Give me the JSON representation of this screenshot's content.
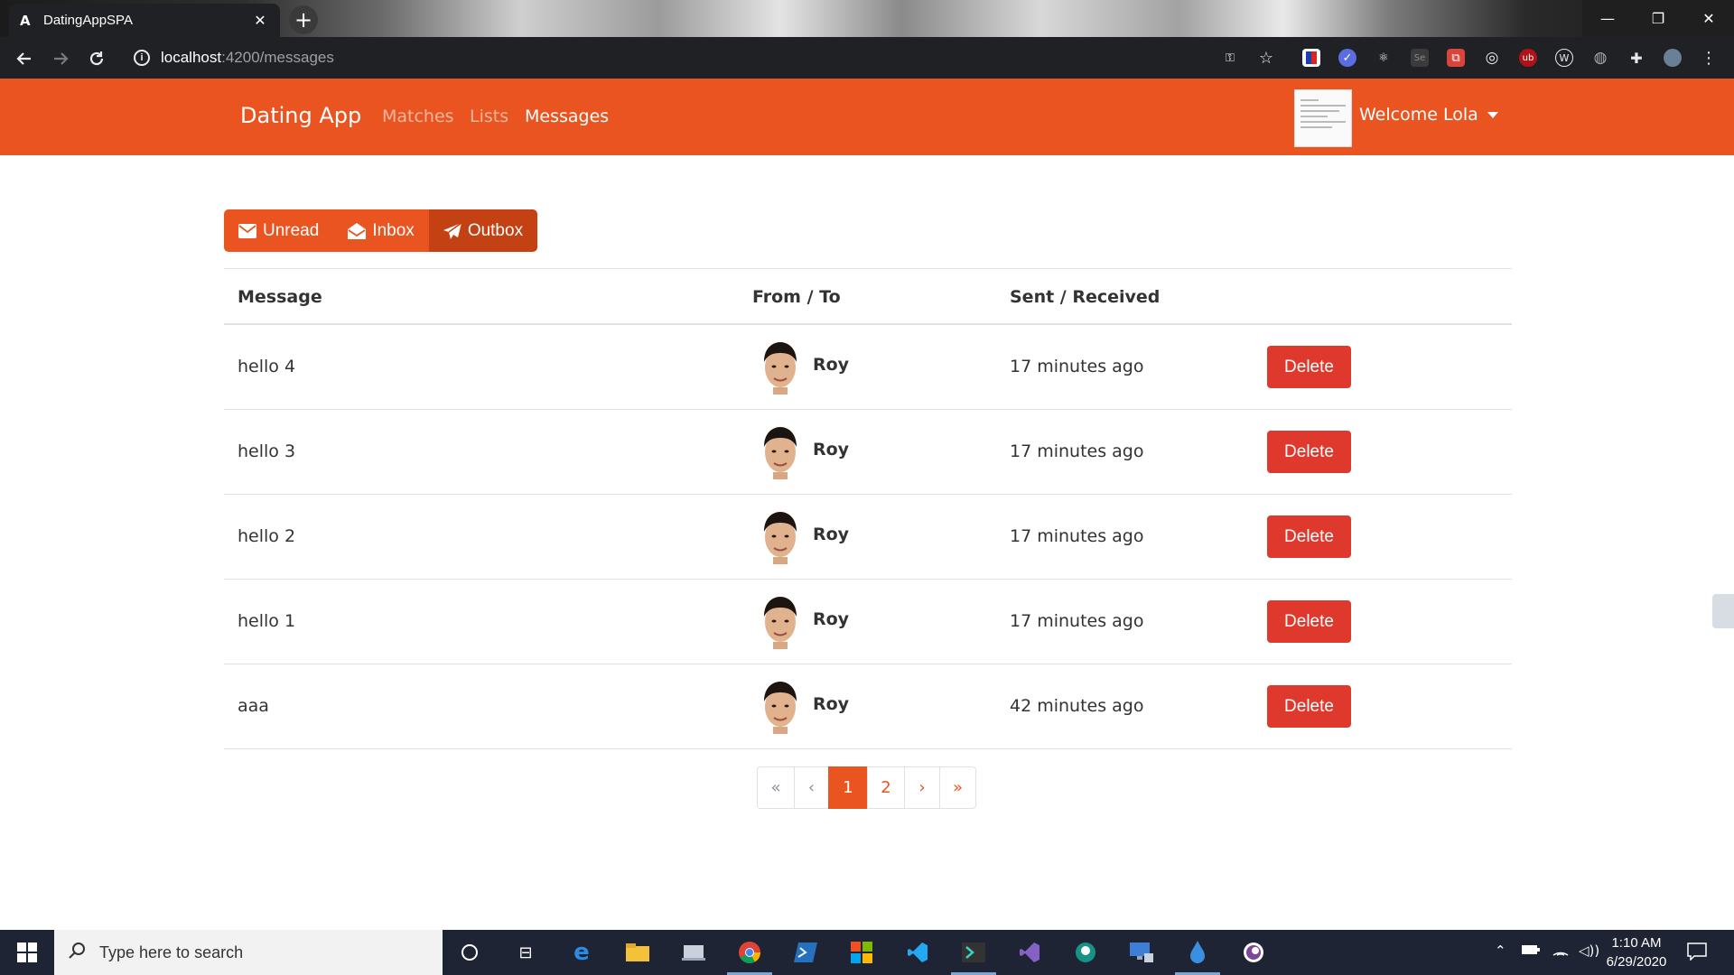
{
  "browser": {
    "tab_favicon": "A",
    "tab_title": "DatingAppSPA",
    "tab_close": "✕",
    "new_tab": "+",
    "url_host": "localhost",
    "url_path": ":4200/messages",
    "win_minimize": "—",
    "win_restore": "❐",
    "win_close": "✕"
  },
  "navbar": {
    "brand": "Dating App",
    "links": [
      "Matches",
      "Lists",
      "Messages"
    ],
    "active_link": "Messages",
    "welcome": "Welcome Lola"
  },
  "message_tabs": [
    {
      "label": "Unread",
      "icon": "envelope-icon"
    },
    {
      "label": "Inbox",
      "icon": "envelope-open-icon"
    },
    {
      "label": "Outbox",
      "icon": "paper-plane-icon",
      "active": true
    }
  ],
  "table": {
    "headers": [
      "Message",
      "From / To",
      "Sent / Received"
    ],
    "rows": [
      {
        "message": "hello 4",
        "name": "Roy",
        "time": "17 minutes ago",
        "action": "Delete"
      },
      {
        "message": "hello 3",
        "name": "Roy",
        "time": "17 minutes ago",
        "action": "Delete"
      },
      {
        "message": "hello 2",
        "name": "Roy",
        "time": "17 minutes ago",
        "action": "Delete"
      },
      {
        "message": "hello 1",
        "name": "Roy",
        "time": "17 minutes ago",
        "action": "Delete"
      },
      {
        "message": "aaa",
        "name": "Roy",
        "time": "42 minutes ago",
        "action": "Delete"
      }
    ]
  },
  "pagination": {
    "first": "«",
    "prev": "‹",
    "pages": [
      "1",
      "2"
    ],
    "current": "1",
    "next": "›",
    "last": "»"
  },
  "taskbar": {
    "search_placeholder": "Type here to search",
    "time": "1:10 AM",
    "date": "6/29/2020"
  },
  "colors": {
    "brand": "#e95420",
    "brand_active": "#c34113",
    "danger": "#df382c",
    "browser_bg": "#202124",
    "taskbar_bg": "#1e2433"
  }
}
